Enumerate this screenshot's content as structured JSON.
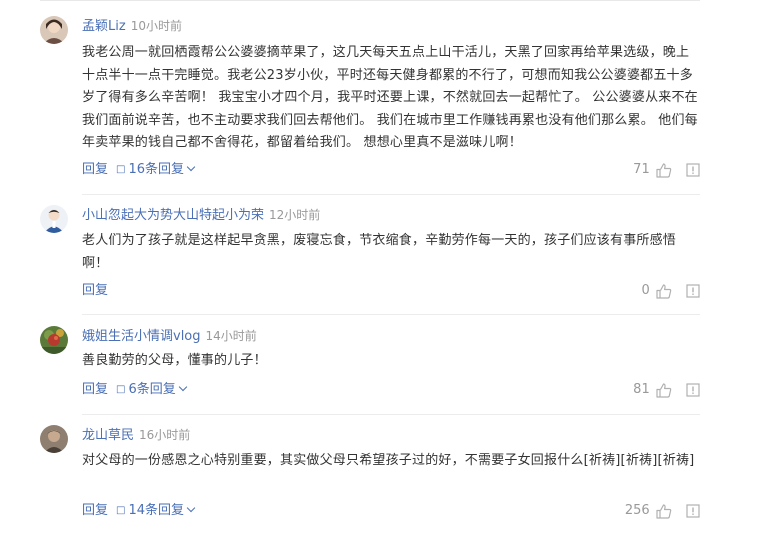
{
  "comments": [
    {
      "username": "孟颖Liz",
      "time": "10小时前",
      "text": "我老公周一就回栖霞帮公公婆婆摘苹果了，这几天每天五点上山干活儿，天黑了回家再给苹果选级，晚上十点半十一点干完睡觉。我老公23岁小伙，平时还每天健身都累的不行了，可想而知我公公婆婆都五十多岁了得有多么辛苦啊！ 我宝宝小才四个月，我平时还要上课，不然就回去一起帮忙了。 公公婆婆从来不在我们面前说辛苦，也不主动要求我们回去帮他们。 我们在城市里工作赚钱再累也没有他们那么累。 他们每年卖苹果的钱自己都不舍得花，都留着给我们。 想想心里真不是滋味儿啊！",
      "reply_label": "回复",
      "replies_label": "16条回复",
      "likes": "71"
    },
    {
      "username": "小山忽起大为势大山特起小为荣",
      "time": "12小时前",
      "text": "老人们为了孩子就是这样起早贪黑，废寝忘食，节衣缩食，辛勤劳作每一天的，孩子们应该有事所感悟啊！",
      "reply_label": "回复",
      "replies_label": "",
      "likes": "0"
    },
    {
      "username": "娥姐生活小情调vlog",
      "time": "14小时前",
      "text": "善良勤劳的父母，懂事的儿子！",
      "reply_label": "回复",
      "replies_label": "6条回复",
      "likes": "81"
    },
    {
      "username": "龙山草民",
      "time": "16小时前",
      "text": "对父母的一份感恩之心特别重要，其实做父母只希望孩子过的好，不需要子女回报什么[祈祷][祈祷][祈祷]",
      "reply_label": "回复",
      "replies_label": "14条回复",
      "likes": "256"
    }
  ],
  "colors": {
    "username": "#4a6fb5",
    "muted": "#999999",
    "text": "#333333"
  },
  "icons": {
    "like": "thumbs-up-icon",
    "report": "report-flag-icon",
    "expand": "chevron-down-icon",
    "replies": "square-bullet-icon"
  }
}
